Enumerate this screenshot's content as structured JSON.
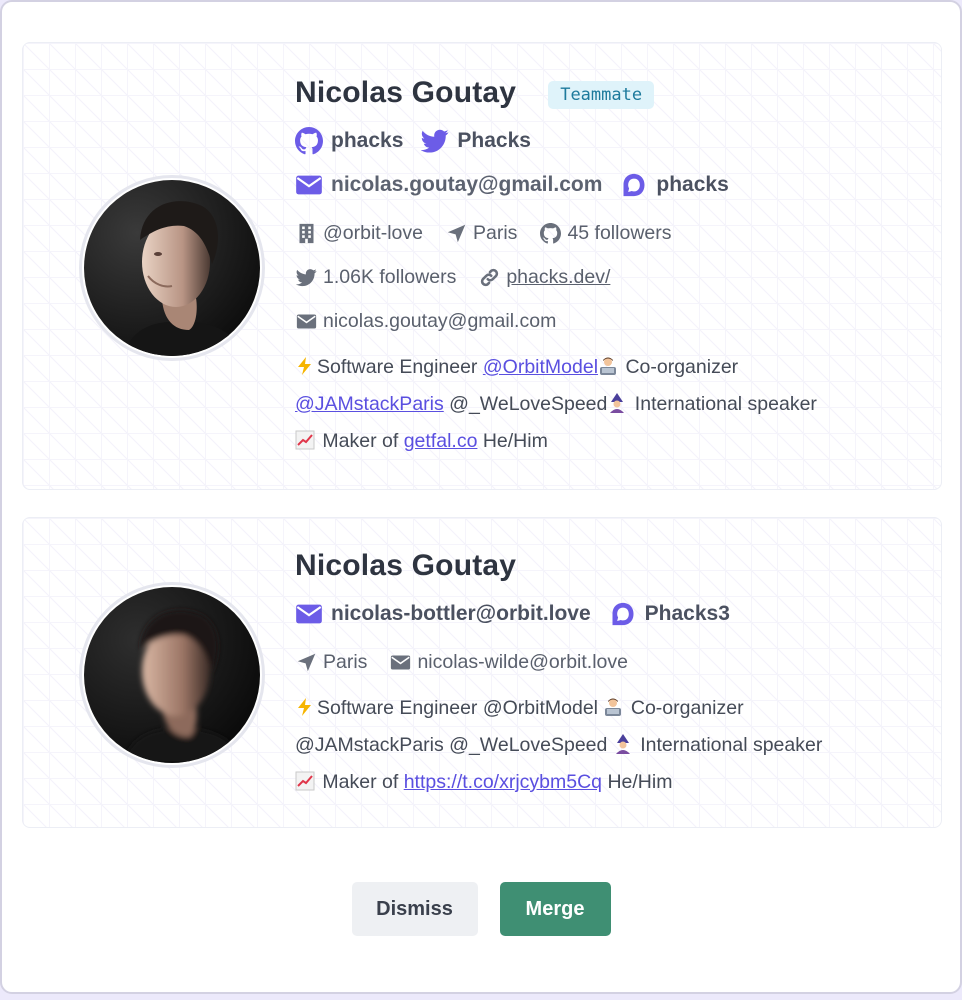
{
  "profiles": [
    {
      "name": "Nicolas Goutay",
      "badge": "Teammate",
      "identities": {
        "github": "phacks",
        "twitter": "Phacks",
        "email": "nicolas.goutay@gmail.com",
        "discourse": "phacks"
      },
      "meta": {
        "company": "@orbit-love",
        "location": "Paris",
        "github_followers": "45 followers",
        "twitter_followers": "1.06K followers",
        "website": "phacks.dev/",
        "email": "nicolas.goutay@gmail.com"
      },
      "bio": {
        "line1_a": "Software Engineer ",
        "line1_link": "@OrbitModel",
        "line1_b": " Co-organizer",
        "line2_link": "@JAMstackParis",
        "line2_b": " @_WeLoveSpeed",
        "line2_c": " International speaker",
        "line3_a": " Maker of ",
        "line3_link": "getfal.co",
        "line3_b": " He/Him"
      }
    },
    {
      "name": "Nicolas Goutay",
      "identities": {
        "email": "nicolas-bottler@orbit.love",
        "discourse": "Phacks3"
      },
      "meta": {
        "location": "Paris",
        "email": "nicolas-wilde@orbit.love"
      },
      "bio": {
        "line1_a": "Software Engineer @OrbitModel ",
        "line1_b": " Co-organizer",
        "line2_a": "@JAMstackParis @_WeLoveSpeed ",
        "line2_c": " International speaker",
        "line3_a": " Maker of ",
        "line3_link": "https://t.co/xrjcybm5Cq",
        "line3_b": " He/Him"
      }
    }
  ],
  "actions": {
    "dismiss_label": "Dismiss",
    "merge_label": "Merge"
  },
  "colors": {
    "accent": "#6c5ce7",
    "merge": "#3f8f73",
    "badge_bg": "#dff3fa",
    "badge_text": "#1d7a9c"
  },
  "icons": [
    "github-icon",
    "twitter-icon",
    "envelope-icon",
    "discourse-icon",
    "building-icon",
    "location-arrow-icon",
    "link-icon",
    "lightning-emoji",
    "technologist-emoji",
    "mage-emoji",
    "chart-emoji"
  ]
}
